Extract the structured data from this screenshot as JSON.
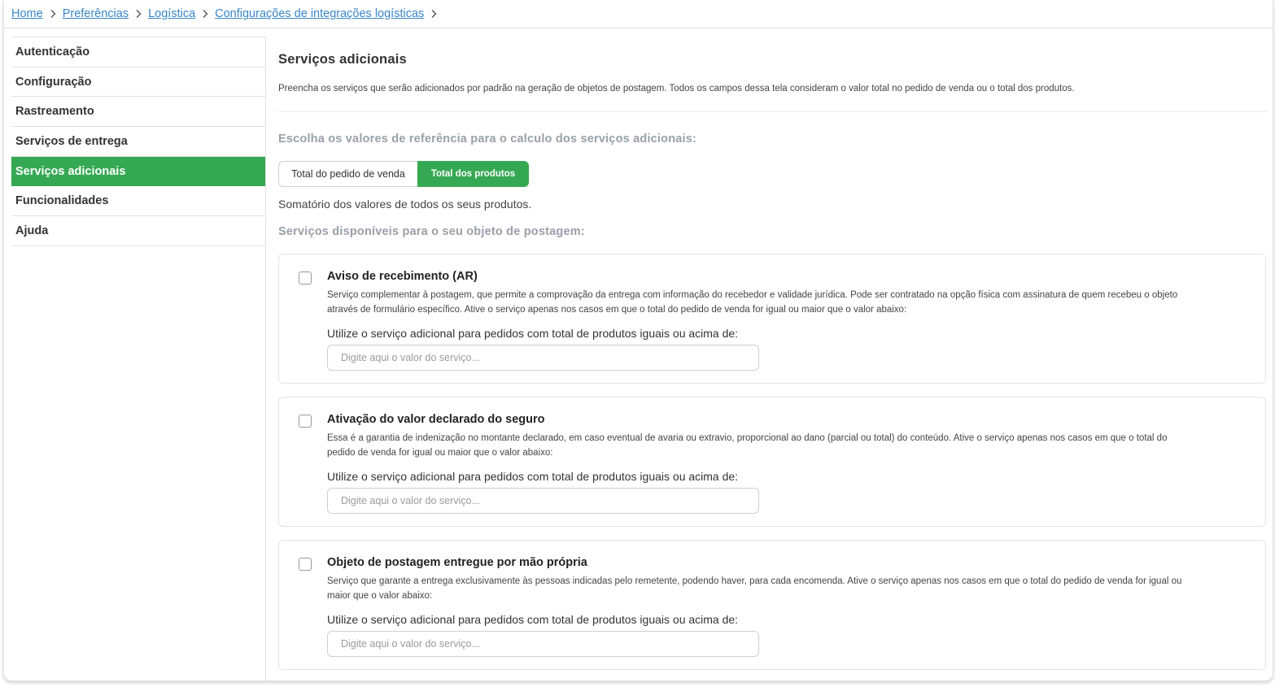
{
  "breadcrumb": {
    "items": [
      "Home",
      "Preferências",
      "Logística",
      "Configurações de integrações logísticas"
    ]
  },
  "sidebar": {
    "items": [
      {
        "label": "Autenticação"
      },
      {
        "label": "Configuração"
      },
      {
        "label": "Rastreamento"
      },
      {
        "label": "Serviços de entrega"
      },
      {
        "label": "Serviços adicionais"
      },
      {
        "label": "Funcionalidades"
      },
      {
        "label": "Ajuda"
      }
    ],
    "active_index": 4
  },
  "main": {
    "title": "Serviços adicionais",
    "description": "Preencha os serviços que serão adicionados por padrão na geração de objetos de postagem. Todos os campos dessa tela consideram o valor total no pedido de venda ou o total dos produtos.",
    "reference_heading": "Escolha os valores de referência para o calculo dos serviços adicionais:",
    "toggle": {
      "option_1": "Total do pedido de venda",
      "option_2": "Total dos produtos",
      "selected": "Total dos produtos"
    },
    "toggle_note": "Somatório dos valores de todos os seus produtos.",
    "services_heading": "Serviços disponíveis para o seu objeto de postagem:",
    "services": [
      {
        "title": "Aviso de recebimento (AR)",
        "text": "Serviço complementar à postagem, que permite a comprovação da entrega com informação do recebedor e validade jurídica. Pode ser contratado na opção física com assinatura de quem recebeu o objeto através de formulário específico. Ative o serviço apenas nos casos em que o total do pedido de venda for igual ou maior que o valor abaixo:",
        "label": "Utilize o serviço adicional para pedidos com total de produtos iguais ou acima de:",
        "placeholder": "Digite aqui o valor do serviço...",
        "checked": false
      },
      {
        "title": "Ativação do valor declarado do seguro",
        "text": "Essa é a garantia de indenização no montante declarado, em caso eventual de avaria ou extravio, proporcional ao dano (parcial ou total) do conteúdo. Ative o serviço apenas nos casos em que o total do pedido de venda for igual ou maior que o valor abaixo:",
        "label": "Utilize o serviço adicional para pedidos com total de produtos iguais ou acima de:",
        "placeholder": "Digite aqui o valor do serviço...",
        "checked": false
      },
      {
        "title": "Objeto de postagem entregue por mão própria",
        "text": "Serviço que garante a entrega exclusivamente às pessoas indicadas pelo remetente, podendo haver, para cada encomenda. Ative o serviço apenas nos casos em que o total do pedido de venda for igual ou maior que o valor abaixo:",
        "label": "Utilize o serviço adicional para pedidos com total de produtos iguais ou acima de:",
        "placeholder": "Digite aqui o valor do serviço...",
        "checked": false
      }
    ]
  },
  "colors": {
    "accent": "#35a853",
    "link": "#3a86c8",
    "muted_heading": "#9aa0a8"
  }
}
